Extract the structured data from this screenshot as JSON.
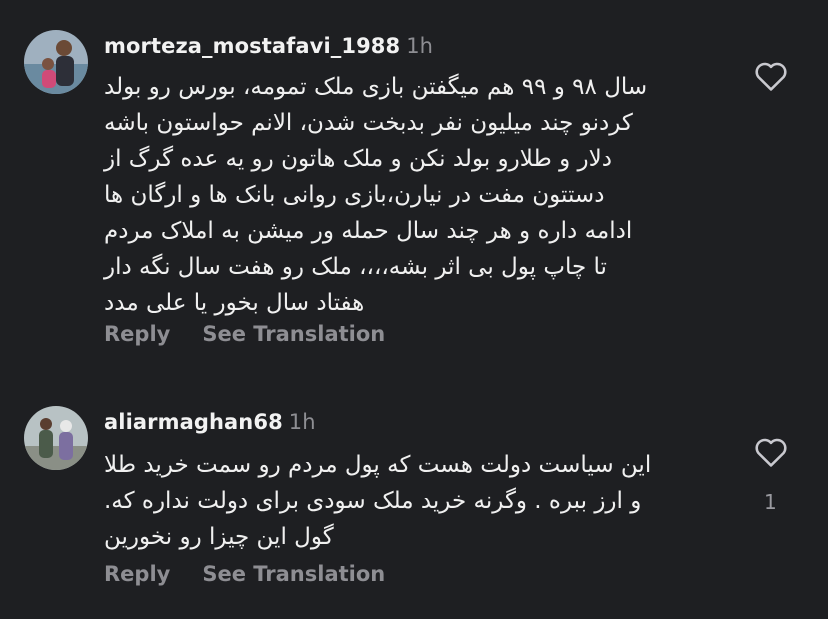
{
  "comments": [
    {
      "username": "morteza_mostafavi_1988",
      "time": "1h",
      "lines": [
        "سال ۹۸ و ۹۹ هم میگفتن بازی ملک تمومه، بورس رو بولد",
        "کردنو چند میلیون نفر بدبخت شدن، الانم حواستون باشه",
        "دلار و طلارو بولد نکن و ملک هاتون رو یه عده گرگ از",
        "دستتون مفت در نیارن،بازی روانی بانک ها و ارگان ها",
        "ادامه داره و هر چند سال حمله ور میشن به املاک مردم",
        "تا چاپ پول بی اثر بشه،،،، ملک رو هفت سال نگه دار",
        "هفتاد سال بخور  یا علی مدد"
      ],
      "reply_label": "Reply",
      "translate_label": "See Translation",
      "likes": ""
    },
    {
      "username": "aliarmaghan68",
      "time": "1h",
      "lines": [
        "این سیاست دولت هست که پول مردم رو سمت خرید طلا",
        "و ارز ببره . وگرنه خرید ملک سودی برای دولت نداره که.",
        "گول این چیزا رو نخورین"
      ],
      "reply_label": "Reply",
      "translate_label": "See Translation",
      "likes": "1"
    }
  ],
  "colors": {
    "background": "#1e1f22",
    "text": "#f0f0f0",
    "muted": "#8e8e93"
  },
  "icons": {
    "like": "heart-outline-icon"
  }
}
